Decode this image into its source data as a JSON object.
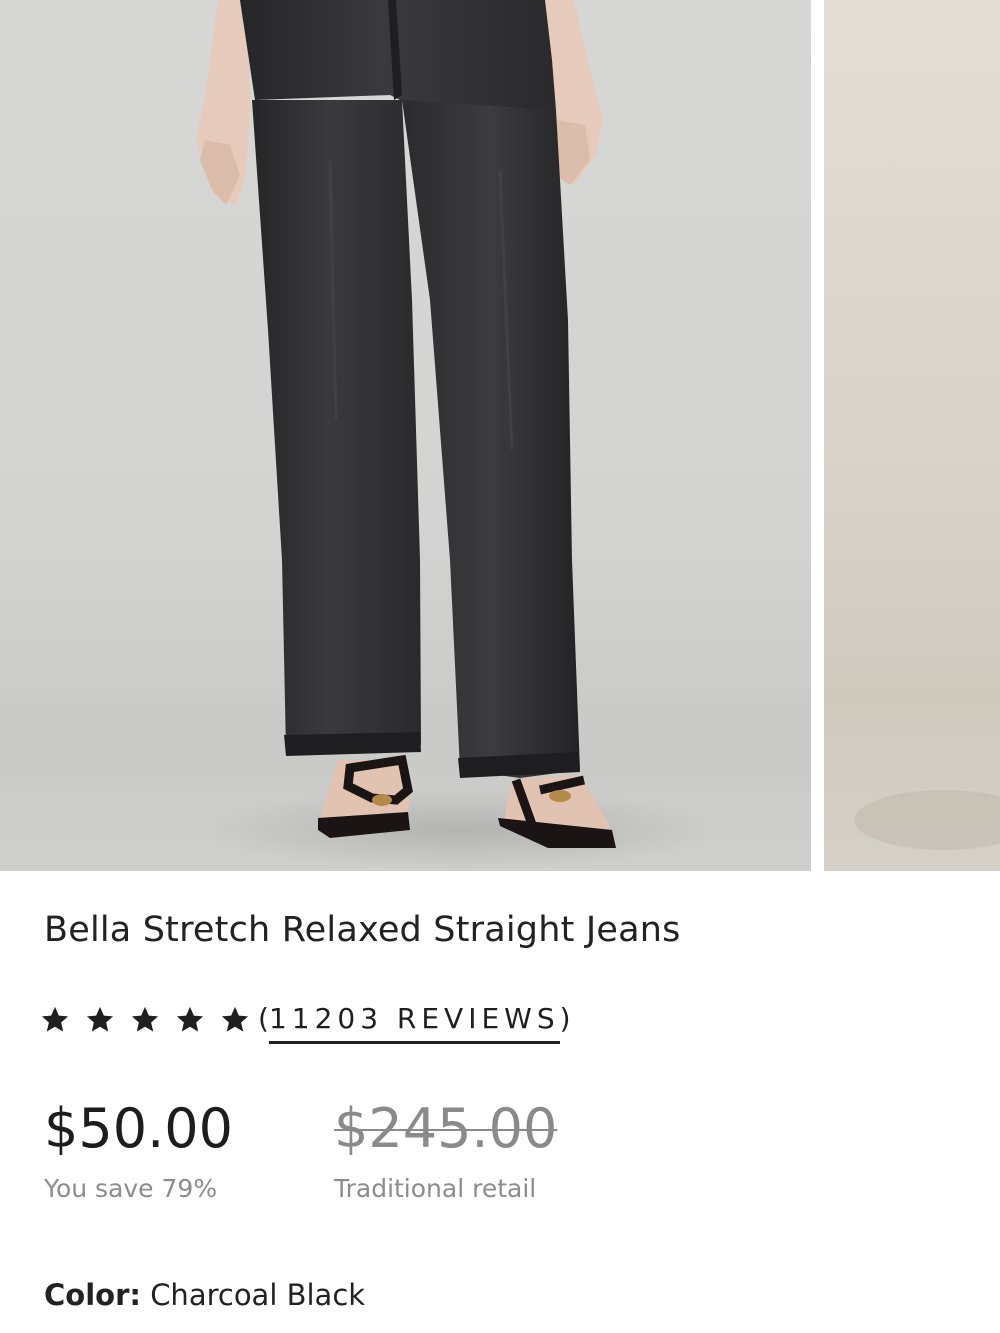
{
  "product": {
    "title": "Bella Stretch Relaxed Straight Jeans",
    "rating": {
      "stars": 5,
      "max_stars": 5,
      "reviews_open": "(",
      "reviews_label": "11203 REVIEWS",
      "reviews_close": ")"
    },
    "price": {
      "current": "$50.00",
      "savings": "You save 79%",
      "retail": "$245.00",
      "retail_label": "Traditional retail"
    },
    "color": {
      "label": "Color:",
      "value": "Charcoal Black"
    }
  },
  "carousel": {
    "images": [
      {
        "icon": "product-photo-jeans-front"
      },
      {
        "icon": "product-photo-next-partial"
      }
    ]
  },
  "colors": {
    "text": "#1f1f1f",
    "muted": "#8c8c8c",
    "denim": "#2f2f31"
  }
}
